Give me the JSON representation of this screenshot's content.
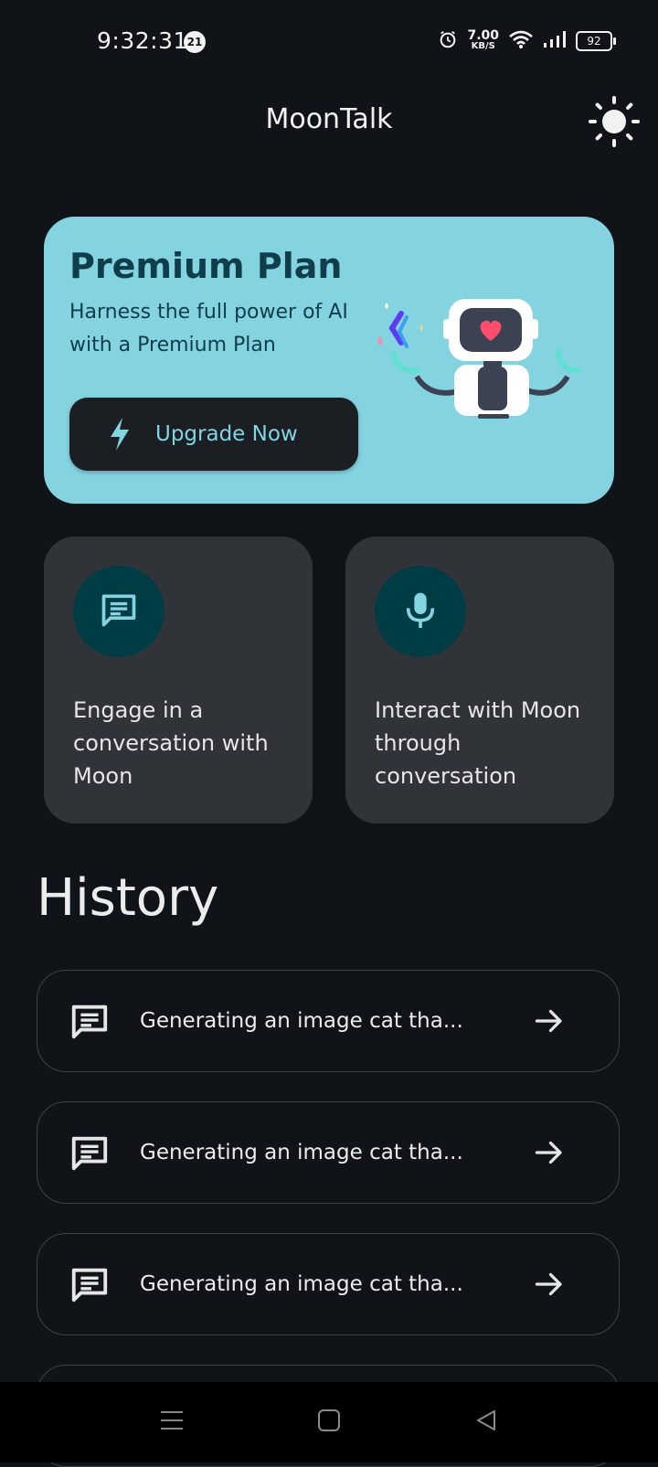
{
  "status_bar": {
    "time": "9:32:31",
    "notification_count": "21",
    "net_speed_value": "7.00",
    "net_speed_unit": "KB/S",
    "battery": "92"
  },
  "app_bar": {
    "title": "MoonTalk",
    "theme_icon": "sun-icon"
  },
  "premium": {
    "title": "Premium Plan",
    "subtitle": "Harness the full power of AI with a Premium Plan",
    "button_label": "Upgrade Now",
    "button_icon": "bolt-icon",
    "colors": {
      "card": "#84d3e1",
      "text": "#0f3d49",
      "button": "#1b1f23"
    }
  },
  "features": [
    {
      "label": "Engage in a conversation with Moon",
      "icon": "chat-icon"
    },
    {
      "label": "Interact with Moon through conversation",
      "icon": "mic-icon"
    }
  ],
  "history": {
    "title": "History",
    "items": [
      {
        "text": "Generating an image cat tha...",
        "icon": "chat-icon",
        "action_icon": "arrow-right-icon"
      },
      {
        "text": "Generating an image cat tha...",
        "icon": "chat-icon",
        "action_icon": "arrow-right-icon"
      },
      {
        "text": "Generating an image cat tha...",
        "icon": "chat-icon",
        "action_icon": "arrow-right-icon"
      }
    ]
  },
  "nav_bar": {
    "icons": [
      "menu-icon",
      "home-square-icon",
      "back-triangle-icon"
    ]
  }
}
